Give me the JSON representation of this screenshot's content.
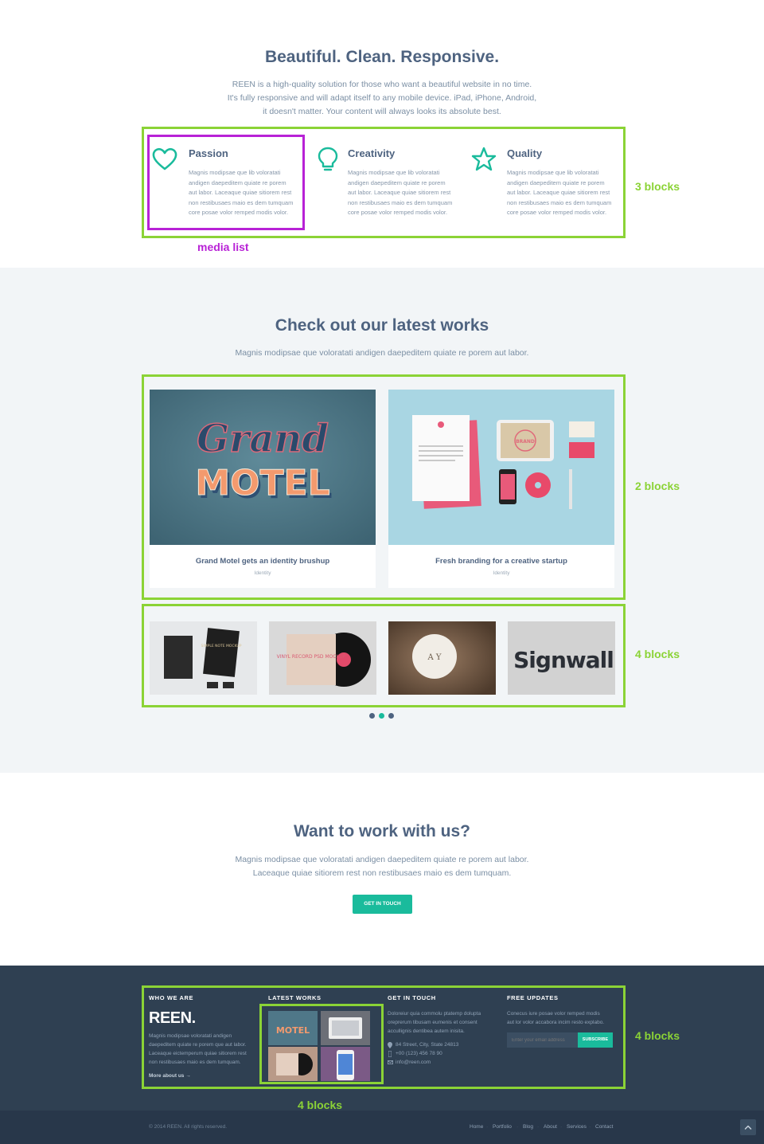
{
  "intro": {
    "title": "Beautiful. Clean. Responsive.",
    "lines": [
      "REEN is a high-quality solution for those who want a beautiful website in no time.",
      "It's fully responsive and will adapt itself to any mobile device. iPad, iPhone, Android,",
      "it doesn't matter. Your content will always looks its absolute best."
    ]
  },
  "features": [
    {
      "icon": "heart-icon",
      "title": "Passion",
      "lines": [
        "Magnis modipsae que lib voloratati",
        "andigen daepeditem quiate re porem",
        "aut labor. Laceaque quiae sitiorem rest",
        "non restibusaes maio es dem tumquam",
        "core posae volor remped modis volor."
      ]
    },
    {
      "icon": "lightbulb-icon",
      "title": "Creativity",
      "lines": [
        "Magnis modipsae que lib voloratati",
        "andigen daepeditem quiate re porem",
        "aut labor. Laceaque quiae sitiorem rest",
        "non restibusaes maio es dem tumquam",
        "core posae volor remped modis volor."
      ]
    },
    {
      "icon": "star-icon",
      "title": "Quality",
      "lines": [
        "Magnis modipsae que lib voloratati",
        "andigen daepeditem quiate re porem",
        "aut labor. Laceaque quiae sitiorem rest",
        "non restibusaes maio es dem tumquam",
        "core posae volor remped modis volor."
      ]
    }
  ],
  "annotations": {
    "three_blocks": "3 blocks",
    "media_list": "media list",
    "two_blocks": "2 blocks",
    "four_blocks_grid": "4 blocks",
    "four_blocks_footer": "4 blocks",
    "four_blocks_works": "4 blocks",
    "colors": {
      "green": "#8bd336",
      "purple": "#b822d6"
    }
  },
  "works": {
    "title": "Check out our latest works",
    "subtitle": "Magnis modipsae que voloratati andigen daepeditem quiate re porem aut labor.",
    "featured": [
      {
        "title": "Grand Motel gets an identity brushup",
        "category": "Identity",
        "image_word_1": "Grand",
        "image_word_2": "MOTEL"
      },
      {
        "title": "Fresh branding for a creative startup",
        "category": "Identity",
        "image_word_1": "BRAND"
      }
    ],
    "thumbs": [
      {
        "name": "stationery-mockup",
        "text": "SIMPLE NOTE MOCKUP"
      },
      {
        "name": "vinyl-record-mockup",
        "text": "VINYL RECORD PSD MOCKUP"
      },
      {
        "name": "badge-mockup",
        "text": "A Y"
      },
      {
        "name": "signwall-mockup",
        "text": "Signwall"
      }
    ],
    "pager": {
      "count": 3,
      "active": 1
    }
  },
  "cta": {
    "title": "Want to work with us?",
    "lines": [
      "Magnis modipsae que voloratati andigen daepeditem quiate re porem aut labor.",
      "Laceaque quiae sitiorem rest non restibusaes maio es dem tumquam."
    ],
    "button": "GET IN TOUCH"
  },
  "footer": {
    "who": {
      "heading": "WHO WE ARE",
      "logo": "REEN.",
      "lines": [
        "Magnis modipsae voloratati andigen",
        "daepeditem quiate re porem que aut labor.",
        "Laceaque eictemperum quiae sitiorem rest",
        "non restibusaes maio es dem tumquam."
      ],
      "more": "More about us",
      "more_arrow": "→"
    },
    "latest": {
      "heading": "LATEST WORKS"
    },
    "contact": {
      "heading": "GET IN TOUCH",
      "lines": [
        "Doloreiur quia commolu ptatemp dolupta",
        "oreprerum tibusam eumenis et consent",
        "accullignis dentibea autem inisita."
      ],
      "address": "84 Street, City, State 24813",
      "phone": "+00 (123) 456 78 90",
      "email": "info@reen.com"
    },
    "updates": {
      "heading": "FREE UPDATES",
      "lines": [
        "Conecus iure posae volor remped modis",
        "aut lor volor accabora incim resto explabo."
      ],
      "placeholder": "Enter your email address",
      "button": "SUBSCRIBE"
    }
  },
  "bottom": {
    "copyright": "© 2014 REEN. All rights reserved.",
    "nav": [
      "Home",
      "Portfolio",
      "Blog",
      "About",
      "Services",
      "Contact"
    ],
    "separator": "·"
  },
  "theme": {
    "accent": "#1abb9c",
    "heading": "#4e6380",
    "footer_bg": "#2f4052"
  }
}
